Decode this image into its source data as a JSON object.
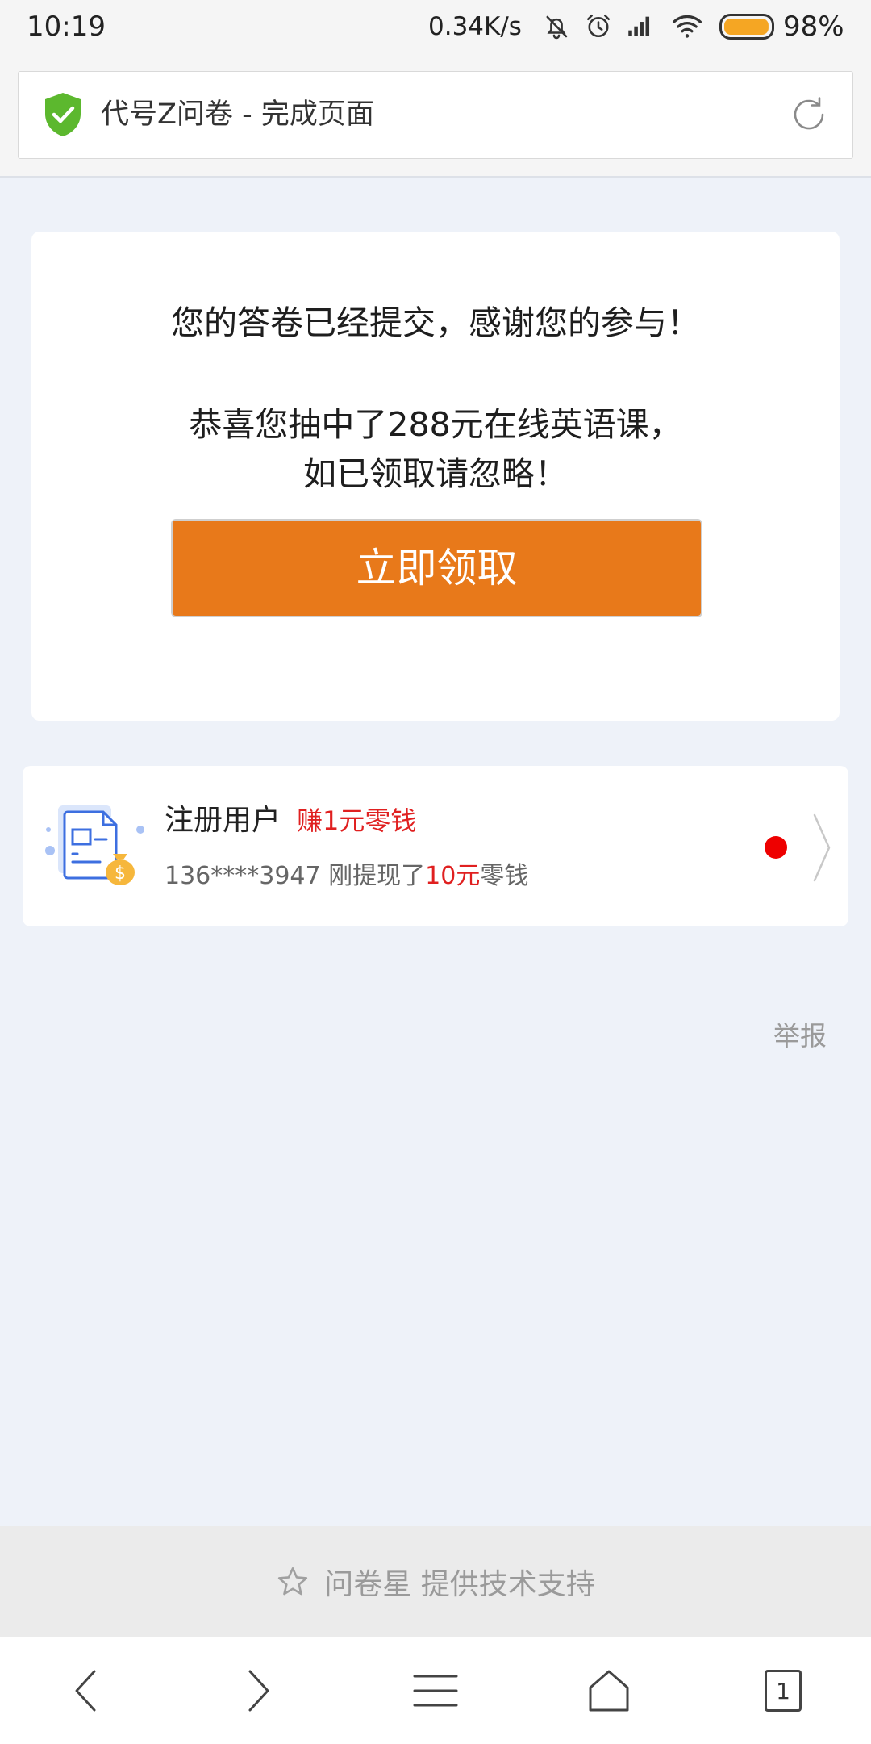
{
  "status_bar": {
    "time": "10:19",
    "net_speed": "0.34K/s",
    "battery_level": "98%",
    "icons": [
      "bell-off-icon",
      "alarm-clock-icon",
      "cell-signal-icon",
      "wifi-icon",
      "battery-icon"
    ]
  },
  "address_bar": {
    "secure_icon": "shield-check-icon",
    "title": "代号Z问卷 - 完成页面",
    "reload_icon": "reload-icon"
  },
  "result_card": {
    "thanks": "您的答卷已经提交，感谢您的参与！",
    "prize_line1": "恭喜您抽中了288元在线英语课，",
    "prize_line2": "如已领取请忽略！",
    "claim_button": "立即领取"
  },
  "promo_card": {
    "illustration_icon": "document-money-bag-icon",
    "title": "注册用户",
    "reward": "赚1元零钱",
    "notice_user": "136****3947 刚提现了",
    "notice_amount": "10元",
    "notice_suffix": "零钱",
    "arrow_icon": "chevron-right-icon"
  },
  "report_link": "举报",
  "footer": {
    "star_icon": "star-outline-icon",
    "text": "问卷星 提供技术支持"
  },
  "bottom_nav": {
    "icons": [
      "back-icon",
      "forward-icon",
      "menu-icon",
      "home-icon",
      "tabs-icon"
    ],
    "tab_count": "1"
  },
  "colors": {
    "page_bg": "#eef2f9",
    "accent": "#e8791a",
    "red": "#e02020",
    "shield_green": "#5cb82e",
    "battery_fill": "#f5a623"
  }
}
